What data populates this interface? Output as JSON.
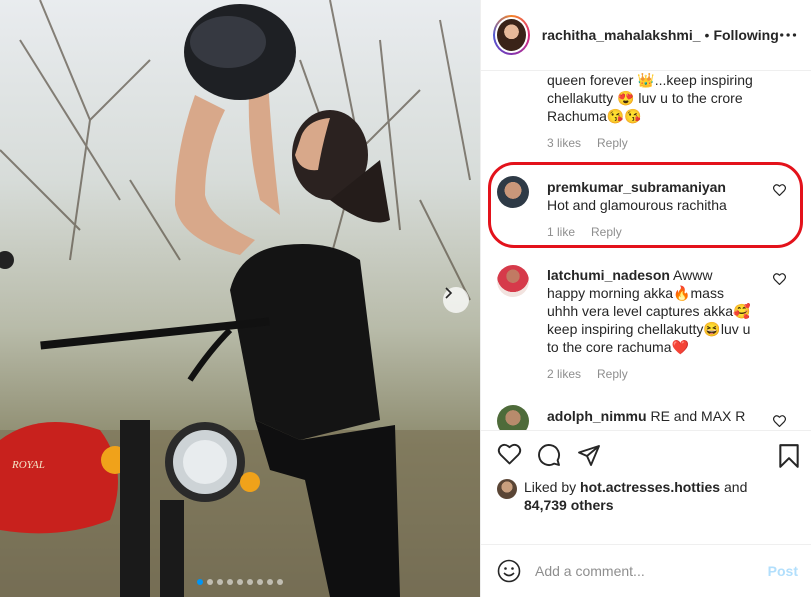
{
  "post": {
    "username": "rachitha_mahalakshmi_",
    "separator": "•",
    "follow_status": "Following",
    "more_icon": "more-horizontal-icon",
    "carousel": {
      "slides": 9,
      "active_index": 0
    }
  },
  "comments": [
    {
      "username": "",
      "text": "queen forever 👑...keep inspiring chellakutty 😍 luv u to the crore Rachuma😘😘",
      "likes": "3 likes",
      "reply": "Reply"
    },
    {
      "username": "premkumar_subramaniyan",
      "text": "Hot and glamourous rachitha",
      "likes": "1 like",
      "reply": "Reply",
      "highlighted": true
    },
    {
      "username": "latchumi_nadeson",
      "text": "Awww happy morning akka🔥mass uhhh vera level captures akka🥰keep inspiring chellakutty😆luv u to the core rachuma❤️",
      "likes": "2 likes",
      "reply": "Reply"
    },
    {
      "username": "adolph_nimmu",
      "text": "RE and MAX R"
    }
  ],
  "actions": {
    "like_icon": "heart-icon",
    "comment_icon": "comment-icon",
    "share_icon": "paper-plane-icon",
    "save_icon": "bookmark-icon"
  },
  "likes": {
    "prefix": "Liked by",
    "by": "hot.actresses.hotties",
    "and": "and",
    "others": "84,739 others"
  },
  "add_comment": {
    "emoji_icon": "smiley-icon",
    "placeholder": "Add a comment...",
    "post_label": "Post"
  },
  "colors": {
    "highlight": "#e3121b",
    "link_disabled": "#b2dffc",
    "muted": "#8e8e8e",
    "carousel_active": "#0095f6"
  }
}
